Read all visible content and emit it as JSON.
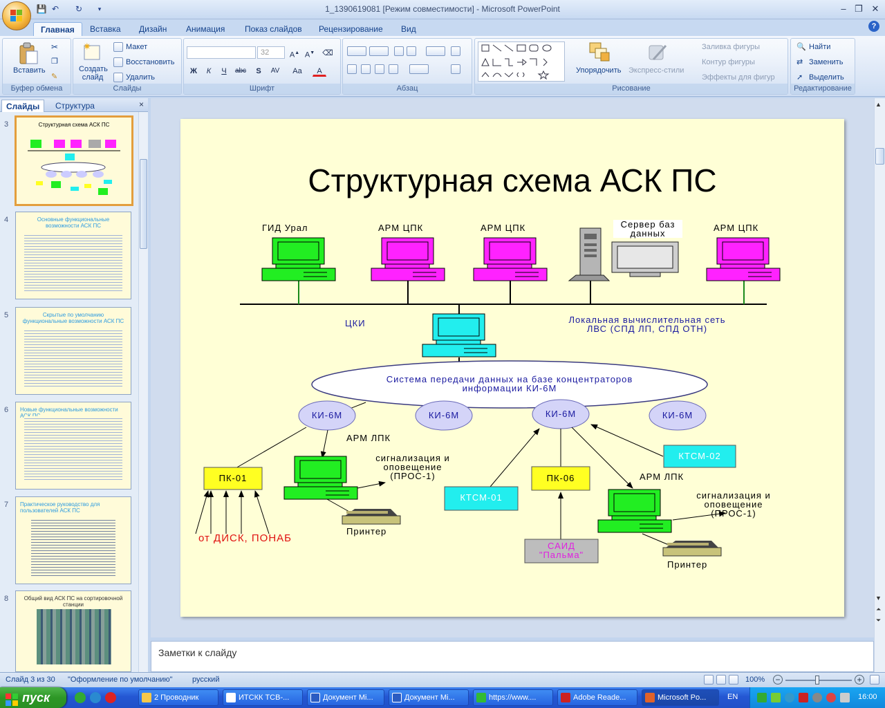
{
  "window": {
    "title": "1_1390619081 [Режим совместимости] - Microsoft PowerPoint",
    "min": "‒",
    "max": "❐",
    "close": "✕",
    "help": "?"
  },
  "ribbon_tabs": [
    "Главная",
    "Вставка",
    "Дизайн",
    "Анимация",
    "Показ слайдов",
    "Рецензирование",
    "Вид"
  ],
  "ribbon": {
    "clipboard": {
      "label": "Буфер обмена",
      "paste": "Вставить"
    },
    "slides": {
      "label": "Слайды",
      "new_slide": "Создать слайд",
      "layout": "Макет",
      "reset": "Восстановить",
      "delete": "Удалить"
    },
    "font": {
      "label": "Шрифт",
      "size": "32",
      "buttons": [
        "Ж",
        "К",
        "Ч",
        "abc",
        "S",
        "AV",
        "Aa",
        "A"
      ]
    },
    "paragraph": {
      "label": "Абзац"
    },
    "drawing": {
      "label": "Рисование",
      "arrange": "Упорядочить",
      "quick_styles": "Экспресс-стили",
      "fill": "Заливка фигуры",
      "outline": "Контур фигуры",
      "effects": "Эффекты для фигур"
    },
    "editing": {
      "label": "Редактирование",
      "find": "Найти",
      "replace": "Заменить",
      "select": "Выделить"
    }
  },
  "pane": {
    "tabs": [
      "Слайды",
      "Структура"
    ],
    "close": "×",
    "thumbs": [
      {
        "num": "3",
        "title": "Структурная схема АСК ПС",
        "selected": true
      },
      {
        "num": "4",
        "title": "Основные функциональные возможности АСК ПС"
      },
      {
        "num": "5",
        "title": "Скрытые по умолчанию функциональные возможности АСК ПС"
      },
      {
        "num": "6",
        "title": "Новые функциональные возможности АСК ПС"
      },
      {
        "num": "7",
        "title": "Практическое руководство для пользователей АСК ПС"
      },
      {
        "num": "8",
        "title": "Общий вид АСК ПС на сортировочной станции"
      }
    ]
  },
  "slide": {
    "title": "Структурная схема АСК ПС",
    "labels": {
      "gid": "ГИД Урал",
      "arm_cpk": "АРМ ЦПК",
      "server1": "Сервер баз",
      "server2": "данных",
      "cki": "ЦКИ",
      "lan1": "Локальная вычислительная сеть",
      "lan2": "ЛВС (СПД ЛП, СПД ОТН)",
      "spd1": "Система передачи данных на базе концентраторов",
      "spd2": "информации КИ-6М",
      "ki": "КИ-6М",
      "arm_lpk": "АРМ ЛПК",
      "pk01": "ПК-01",
      "pk06": "ПК-06",
      "ktsm01": "КТСМ-01",
      "ktsm02": "КТСМ-02",
      "signal1": "сигнализация и",
      "signal2": "оповещение",
      "signal3": "(ПРОС-1)",
      "printer": "Принтер",
      "from": "от ДИСК, ПОНАБ",
      "said1": "САИД",
      "said2": "\"Пальма\""
    }
  },
  "notes_placeholder": "Заметки к слайду",
  "status": {
    "slide": "Слайд 3 из 30",
    "theme": "\"Оформление по умолчанию\"",
    "lang": "русский",
    "zoom": "100%"
  },
  "taskbar": {
    "start": "пуск",
    "tasks": [
      "2 Проводник",
      "ИТСКК ТСВ-...",
      "Документ Mi...",
      "Документ Mi...",
      "https://www....",
      "Adobe Reade...",
      "Microsoft Po..."
    ],
    "lang": "EN",
    "time": "16:00"
  },
  "colors": {
    "accent": "#2a5cc7",
    "slide_bg": "#ffffd6",
    "green_pc": "#22ee22",
    "magenta_pc": "#ff22ff",
    "cyan_pc": "#22eeee"
  }
}
